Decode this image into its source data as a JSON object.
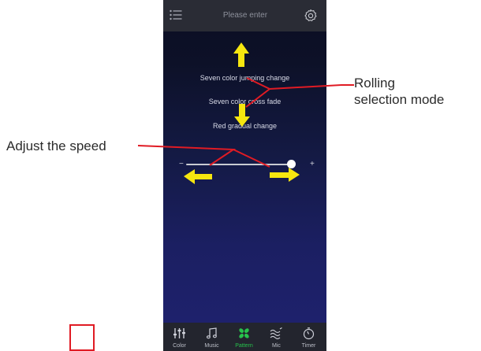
{
  "header": {
    "search_placeholder": "Please enter",
    "menu_icon": "list-menu-icon",
    "settings_icon": "gear-icon"
  },
  "modes": [
    {
      "label": "Seven color jumping change"
    },
    {
      "label": "Seven color cross fade"
    },
    {
      "label": "Red gradual change"
    }
  ],
  "speed_slider": {
    "minus_label": "−",
    "plus_label": "+",
    "value_fraction": 0.97
  },
  "tabs": [
    {
      "label": "Color",
      "icon": "sliders-icon",
      "active": false
    },
    {
      "label": "Music",
      "icon": "music-note-icon",
      "active": false
    },
    {
      "label": "Pattern",
      "icon": "pattern-fan-icon",
      "active": true
    },
    {
      "label": "Mic",
      "icon": "mic-wave-icon",
      "active": false
    },
    {
      "label": "Timer",
      "icon": "timer-icon",
      "active": false
    }
  ],
  "annotations": {
    "rolling_line1": "Rolling",
    "rolling_line2": "selection mode",
    "speed": "Adjust the speed"
  },
  "colors": {
    "arrow": "#f6e60f",
    "callout_line": "#e01b24",
    "active_tab": "#27c24c"
  }
}
